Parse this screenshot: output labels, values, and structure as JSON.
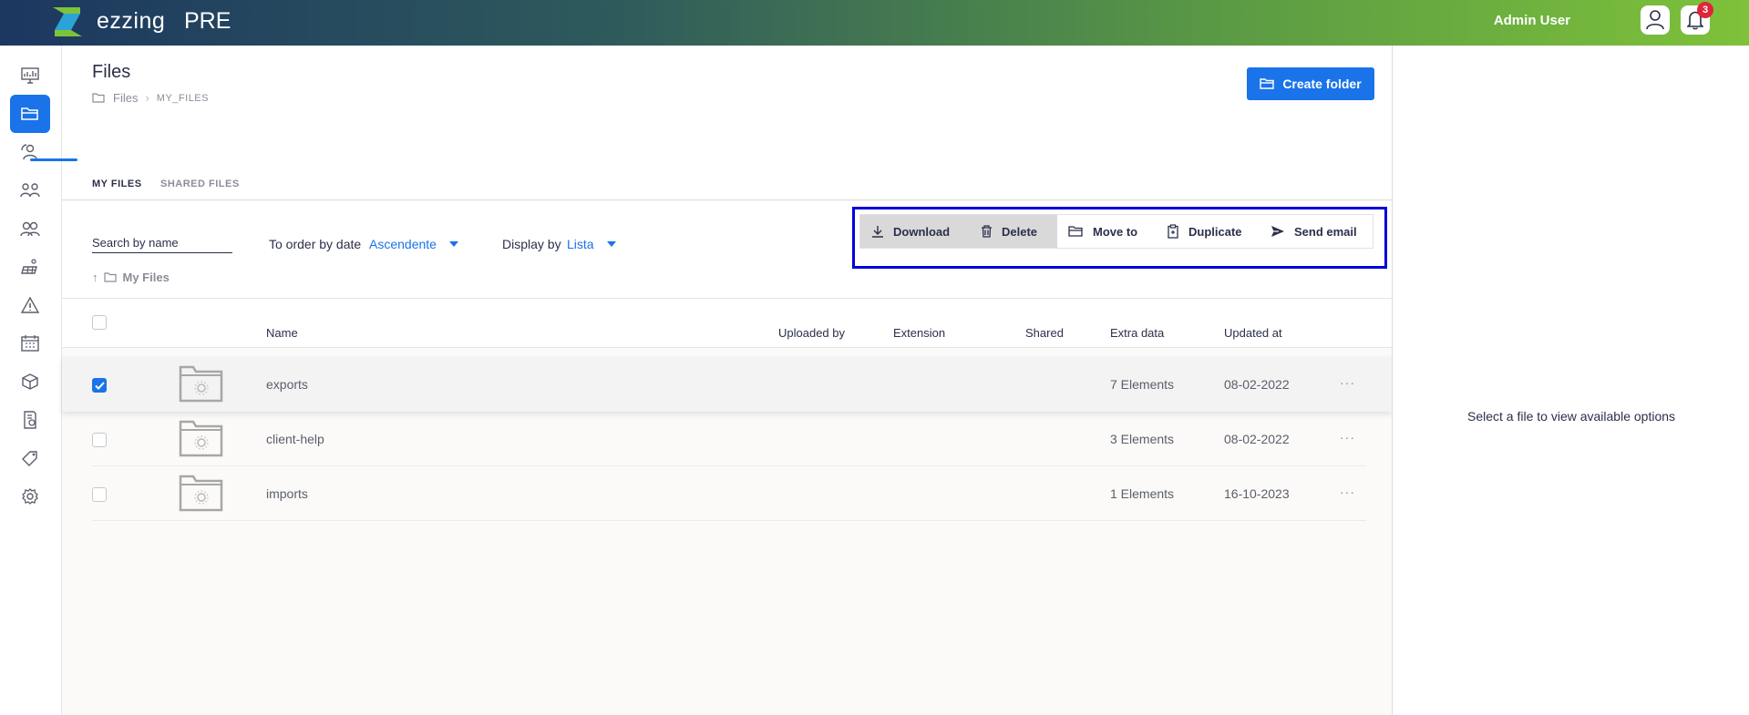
{
  "app": {
    "brand": "ezzing",
    "environment": "PRE"
  },
  "header": {
    "user_name": "Admin User",
    "notifications_count": "3"
  },
  "sidebar": {
    "items": [
      {
        "icon": "monitor-dashboard-icon"
      },
      {
        "icon": "folder-icon",
        "active": true
      },
      {
        "icon": "users-refresh-icon"
      },
      {
        "icon": "team-network-icon"
      },
      {
        "icon": "users-group-icon"
      },
      {
        "icon": "solar-panel-icon"
      },
      {
        "icon": "warning-triangle-icon"
      },
      {
        "icon": "calendar-icon"
      },
      {
        "icon": "box-icon"
      },
      {
        "icon": "invoice-icon"
      },
      {
        "icon": "tag-icon"
      },
      {
        "icon": "settings-gear-icon"
      }
    ]
  },
  "page": {
    "title": "Files",
    "breadcrumb": {
      "root": "Files",
      "current": "MY_FILES"
    },
    "create_folder_label": "Create folder"
  },
  "tabs": {
    "my_files": "MY FILES",
    "shared_files": "SHARED FILES"
  },
  "filters": {
    "search_placeholder": "Search by name",
    "order_label": "To order by date",
    "order_value": "Ascendente",
    "display_label": "Display by",
    "display_value": "Lista"
  },
  "path": {
    "current": "My Files"
  },
  "actions": {
    "download": "Download",
    "delete": "Delete",
    "move_to": "Move to",
    "duplicate": "Duplicate",
    "send_email": "Send email"
  },
  "table": {
    "columns": {
      "name": "Name",
      "uploaded_by": "Uploaded by",
      "extension": "Extension",
      "shared": "Shared",
      "extra_data": "Extra data",
      "updated_at": "Updated at"
    },
    "rows": [
      {
        "name": "exports",
        "extra": "7 Elements",
        "updated": "08-02-2022",
        "checked": true
      },
      {
        "name": "client-help",
        "extra": "3 Elements",
        "updated": "08-02-2022",
        "checked": false
      },
      {
        "name": "imports",
        "extra": "1 Elements",
        "updated": "16-10-2023",
        "checked": false
      }
    ],
    "more_label": "···"
  },
  "right_panel": {
    "message": "Select a file to view available options"
  },
  "colors": {
    "accent": "#1a73e8",
    "highlight_frame": "#0000d9",
    "badge": "#e0253a"
  }
}
